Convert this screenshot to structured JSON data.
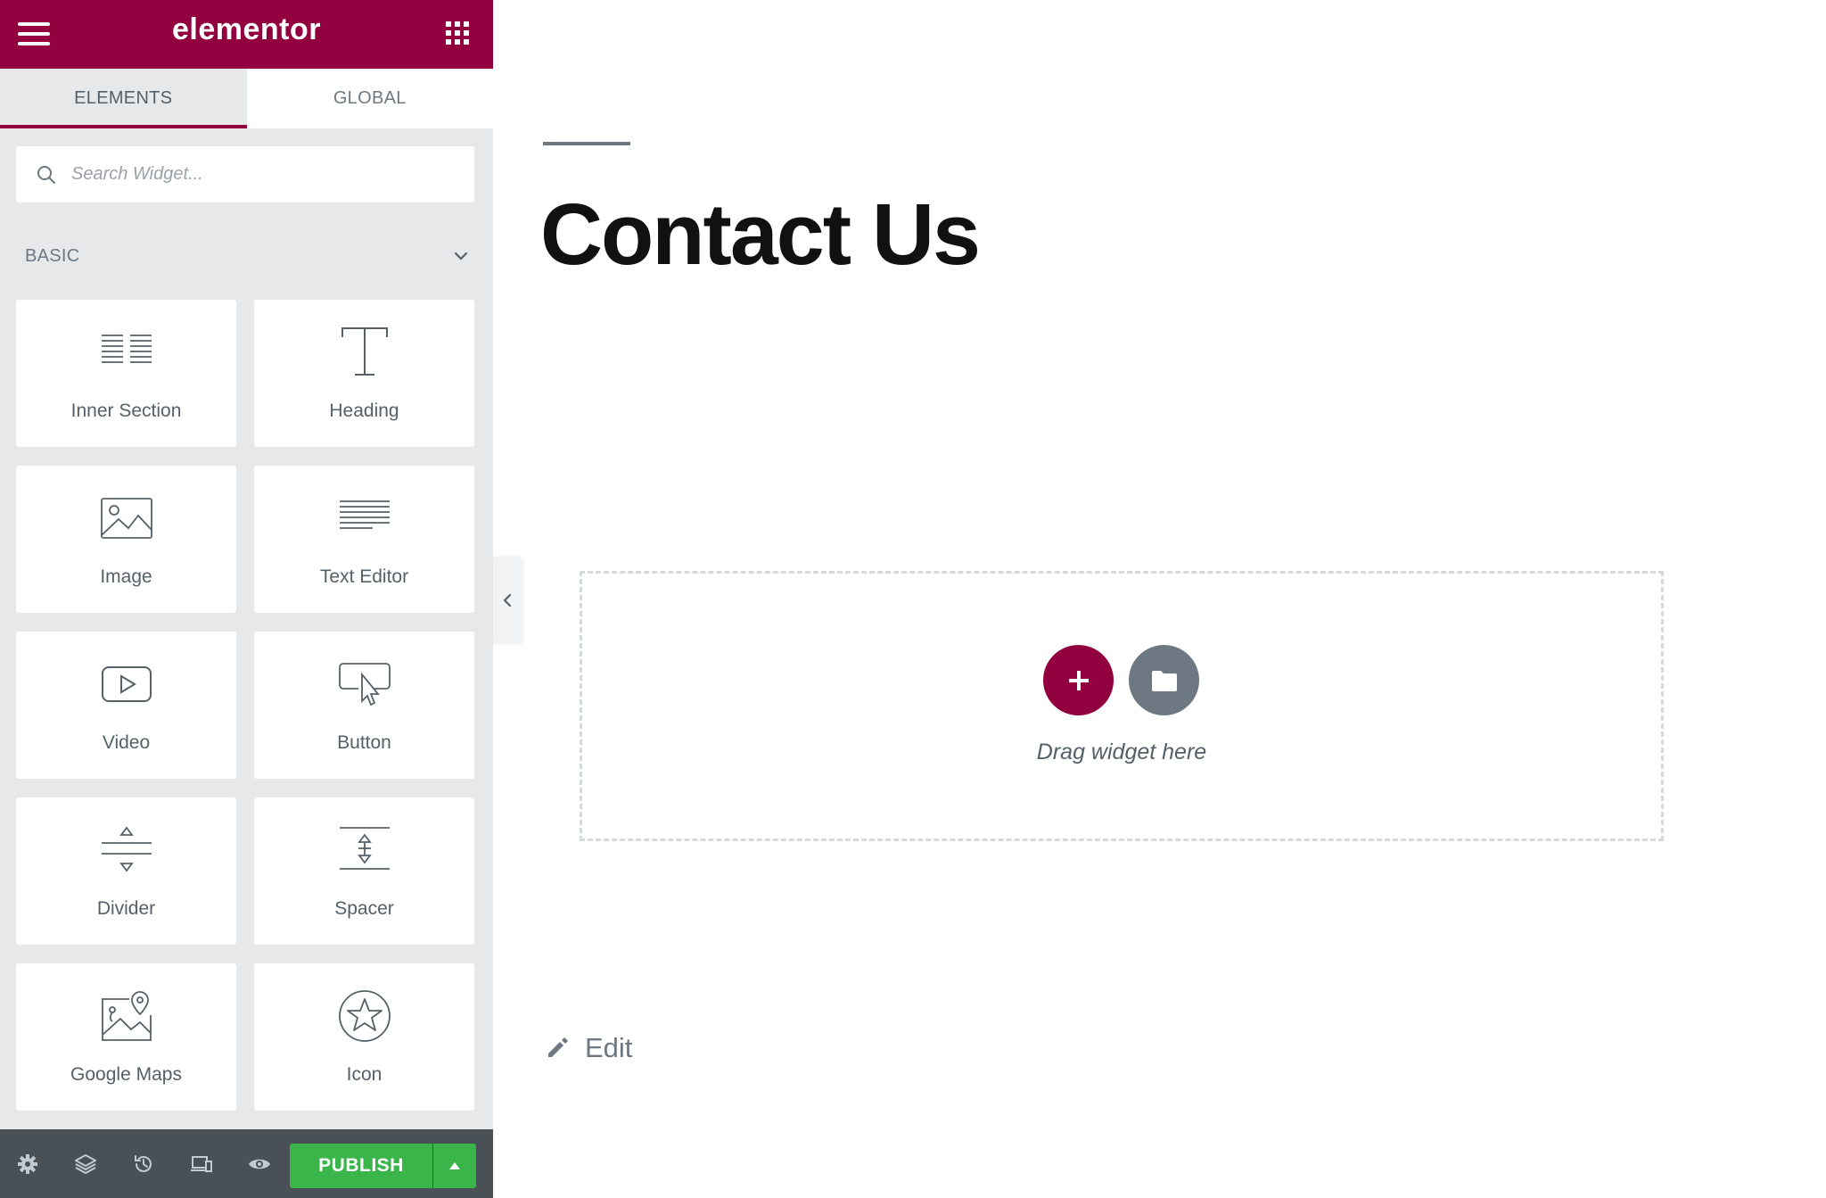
{
  "header": {
    "logo": "elementor"
  },
  "tabs": [
    {
      "label": "ELEMENTS",
      "active": true
    },
    {
      "label": "GLOBAL",
      "active": false
    }
  ],
  "search": {
    "placeholder": "Search Widget...",
    "value": ""
  },
  "category": {
    "title": "BASIC",
    "expanded": true
  },
  "widgets": [
    {
      "label": "Inner Section",
      "icon": "inner-section-icon"
    },
    {
      "label": "Heading",
      "icon": "heading-icon"
    },
    {
      "label": "Image",
      "icon": "image-icon"
    },
    {
      "label": "Text Editor",
      "icon": "text-editor-icon"
    },
    {
      "label": "Video",
      "icon": "video-icon"
    },
    {
      "label": "Button",
      "icon": "button-icon"
    },
    {
      "label": "Divider",
      "icon": "divider-icon"
    },
    {
      "label": "Spacer",
      "icon": "spacer-icon"
    },
    {
      "label": "Google Maps",
      "icon": "google-maps-icon"
    },
    {
      "label": "Icon",
      "icon": "star-icon"
    }
  ],
  "footer": {
    "icons": [
      "settings-icon",
      "navigator-icon",
      "history-icon",
      "responsive-icon",
      "preview-icon"
    ],
    "publish_label": "PUBLISH"
  },
  "canvas": {
    "title": "Contact Us",
    "dropzone_text": "Drag widget here",
    "edit_label": "Edit"
  },
  "colors": {
    "brand": "#93003f",
    "publish": "#39b54a",
    "panel_bg": "#e6e8ea",
    "footer_bg": "#495157",
    "muted": "#6d7882"
  }
}
